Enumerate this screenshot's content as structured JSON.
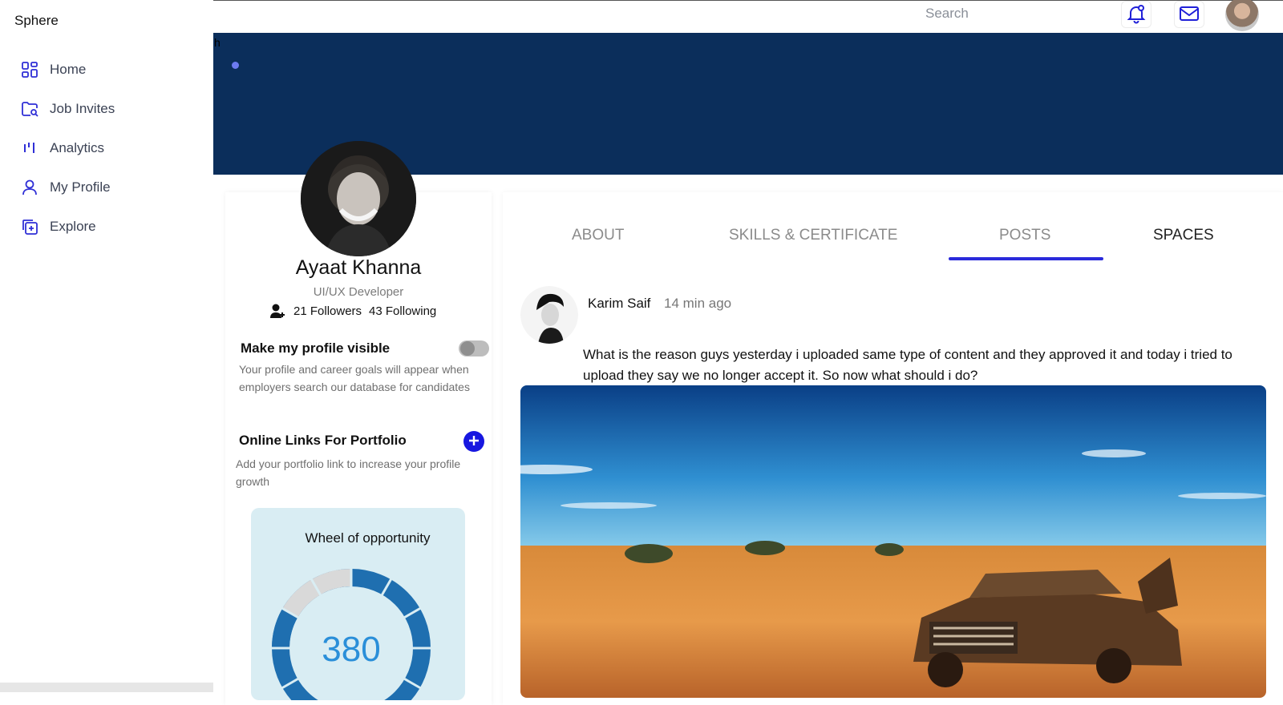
{
  "app": {
    "name": "Sphere"
  },
  "nav": [
    {
      "label": "Home",
      "icon": "grid-icon"
    },
    {
      "label": "Job Invites",
      "icon": "folder-search-icon"
    },
    {
      "label": "Analytics",
      "icon": "analytics-icon"
    },
    {
      "label": "My Profile",
      "icon": "user-icon"
    },
    {
      "label": "Explore",
      "icon": "add-copy-icon"
    }
  ],
  "topbar": {
    "search_placeholder": "Search",
    "bell_icon": "bell-icon",
    "mail_icon": "mail-icon"
  },
  "banner": {
    "stray_text": "h"
  },
  "profile": {
    "name": "Ayaat Khanna",
    "role": "UI/UX Developer",
    "followers": "21 Followers",
    "following": "43 Following",
    "visibility_title": "Make my profile visible",
    "visibility_desc": "Your profile and career goals will appear when employers search our database for candidates",
    "visibility_on": false,
    "links_title": "Online Links For Portfolio",
    "links_desc": "Add your portfolio link to increase your profile growth",
    "wheel_title": "Wheel of opportunity",
    "wheel_value": "380"
  },
  "tabs": [
    {
      "label": "ABOUT"
    },
    {
      "label": "SKILLS & CERTIFICATE"
    },
    {
      "label": "POSTS",
      "active": true
    },
    {
      "label": "SPACES"
    }
  ],
  "post": {
    "author": "Karim Saif",
    "time": "14 min ago",
    "text": "What is the reason guys yesterday i uploaded same type of content and they approved it and today i tried to upload they say we no longer accept it. So now what should i do?"
  },
  "colors": {
    "accent": "#2a2adb",
    "banner": "#0b2e5b",
    "wheel": "#1f6fb0"
  }
}
